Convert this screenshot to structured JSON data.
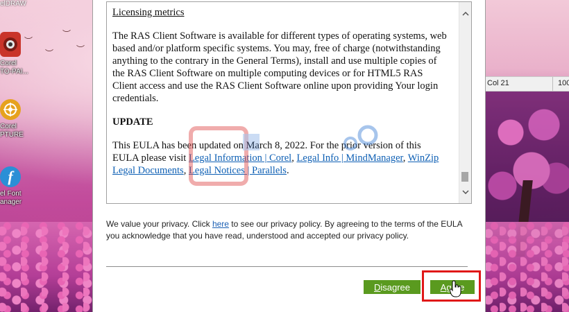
{
  "desktop": {
    "top_label": "elDRAW",
    "icons": [
      {
        "name": "corel-photo-paint",
        "label": "Corel\nTO-PAI...",
        "color": "#d63a2e",
        "glyph": "●"
      },
      {
        "name": "corel-capture",
        "label": "Corel\nPTURE",
        "color": "#e6a21e",
        "glyph": "◎"
      },
      {
        "name": "corel-font-manager",
        "label": "el Font\nanager",
        "color": "#2a8fd6",
        "glyph": "f"
      }
    ]
  },
  "background_window": {
    "column": "Col 21",
    "zoom": "100"
  },
  "dialog": {
    "eula": {
      "section_heading": "Licensing metrics",
      "body": "The RAS Client Software is available for different types of operating systems, web based and/or platform specific systems. You may, free of charge (notwithstanding anything to the contrary in the General Terms), install and use multiple copies of the RAS Client Software on multiple computing devices or for HTML5 RAS Client access and use the RAS Client Software online upon providing Your login credentials.",
      "update_heading": "UPDATE",
      "update_text_before": "This EULA has been updated on March 8, 2022. For the prior version of this EULA please visit ",
      "links": [
        "Legal Information | Corel",
        "Legal Info | MindManager",
        "WinZip Legal Documents",
        "Legal Notices | Parallels"
      ],
      "separator": ", ",
      "final_punct": "."
    },
    "privacy": {
      "before_link": "We value your privacy. Click ",
      "link": "here",
      "after_link": " to see our privacy policy. By agreeing to the terms of the EULA you acknowledge that you have read, understood and accepted our privacy policy."
    },
    "buttons": {
      "disagree_mnemonic": "D",
      "disagree_rest": "isagree",
      "agree_mnemonic": "A",
      "agree_rest": "gree"
    }
  },
  "colors": {
    "button_green": "#5a9a1f",
    "link_blue": "#0d5fb4",
    "highlight_red": "#e01818"
  }
}
